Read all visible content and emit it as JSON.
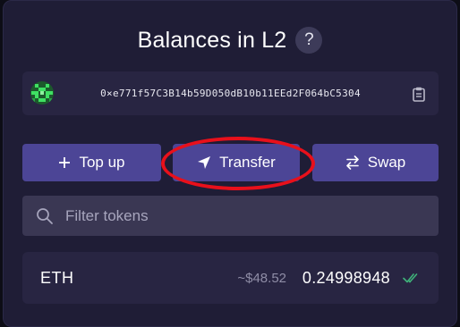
{
  "header": {
    "title": "Balances in L2",
    "help_label": "?"
  },
  "account": {
    "address": "0×e771f57C3B14b59D050dB10b11EEd2F064bC5304"
  },
  "actions": {
    "top_up_label": "Top up",
    "transfer_label": "Transfer",
    "swap_label": "Swap"
  },
  "filter": {
    "placeholder": "Filter tokens",
    "value": ""
  },
  "tokens": [
    {
      "symbol": "ETH",
      "usd_value": "~$48.52",
      "amount": "0.24998948"
    }
  ],
  "icons": {
    "avatar": "identicon-avatar",
    "copy": "clipboard-icon",
    "top_up": "plus-icon",
    "transfer": "send-icon",
    "swap": "swap-arrows-icon",
    "search": "search-icon",
    "verified": "double-check-icon"
  },
  "colors": {
    "background": "#1f1d36",
    "button": "#4c4596",
    "highlight": "#e8101b",
    "verified": "#3fb37a"
  }
}
